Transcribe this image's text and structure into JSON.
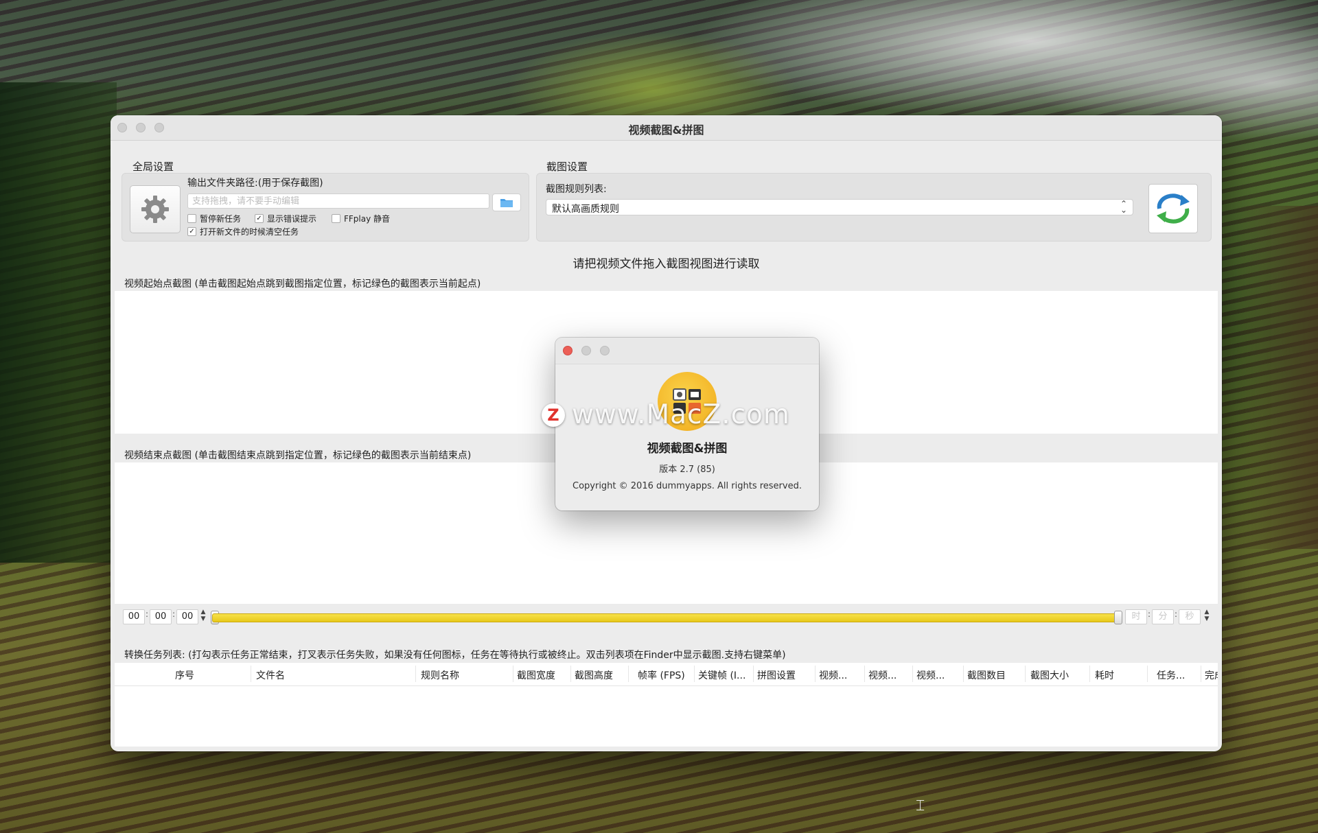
{
  "window": {
    "title": "视频截图&拼图"
  },
  "global_settings": {
    "title": "全局设置",
    "output_path_label": "输出文件夹路径:(用于保存截图)",
    "output_path_placeholder": "支持拖拽，请不要手动编辑",
    "output_path_value": "",
    "options": [
      {
        "label": "暂停新任务",
        "checked": false
      },
      {
        "label": "显示错误提示",
        "checked": true
      },
      {
        "label": "FFplay 静音",
        "checked": false
      },
      {
        "label": "打开新文件的时候清空任务",
        "checked": true
      }
    ],
    "icons": {
      "settings": "gear-icon",
      "folder": "folder-icon"
    }
  },
  "capture_settings": {
    "title": "截图设置",
    "rules_label": "截图规则列表:",
    "selected_rule": "默认高画质规则",
    "icons": {
      "refresh": "refresh-icon"
    }
  },
  "main": {
    "prompt": "请把视频文件拖入截图视图进行读取",
    "start_section_label": "视频起始点截图 (单击截图起始点跳到截图指定位置，标记绿色的截图表示当前起点)",
    "end_section_label": "视频结束点截图 (单击截图结束点跳到指定位置，标记绿色的截图表示当前结束点)"
  },
  "timeline": {
    "start_time": [
      "00",
      "00",
      "00"
    ],
    "end_time_placeholders": [
      "时",
      "分",
      "秒"
    ],
    "accent": "#f2d430"
  },
  "tasks": {
    "label": "转换任务列表: (打勾表示任务正常结束，打叉表示任务失败，如果没有任何图标，任务在等待执行或被终止。双击列表项在Finder中显示截图.支持右键菜单)",
    "columns": [
      "序号",
      "文件名",
      "规则名称",
      "截图宽度",
      "截图高度",
      "帧率 (FPS)",
      "关键帧 (I...",
      "拼图设置",
      "视频...",
      "视频...",
      "视频...",
      "截图数目",
      "截图大小",
      "耗时",
      "任务...",
      "完成"
    ]
  },
  "about_dialog": {
    "app_name": "视频截图&拼图",
    "version": "版本 2.7 (85)",
    "copyright": "Copyright © 2016 dummyapps. All rights reserved.",
    "icons": {
      "app": "app-icon",
      "close": "close-icon"
    },
    "close_color": "#ec5f57"
  },
  "watermark": {
    "badge": "Z",
    "text": "www.MacZ.com"
  }
}
